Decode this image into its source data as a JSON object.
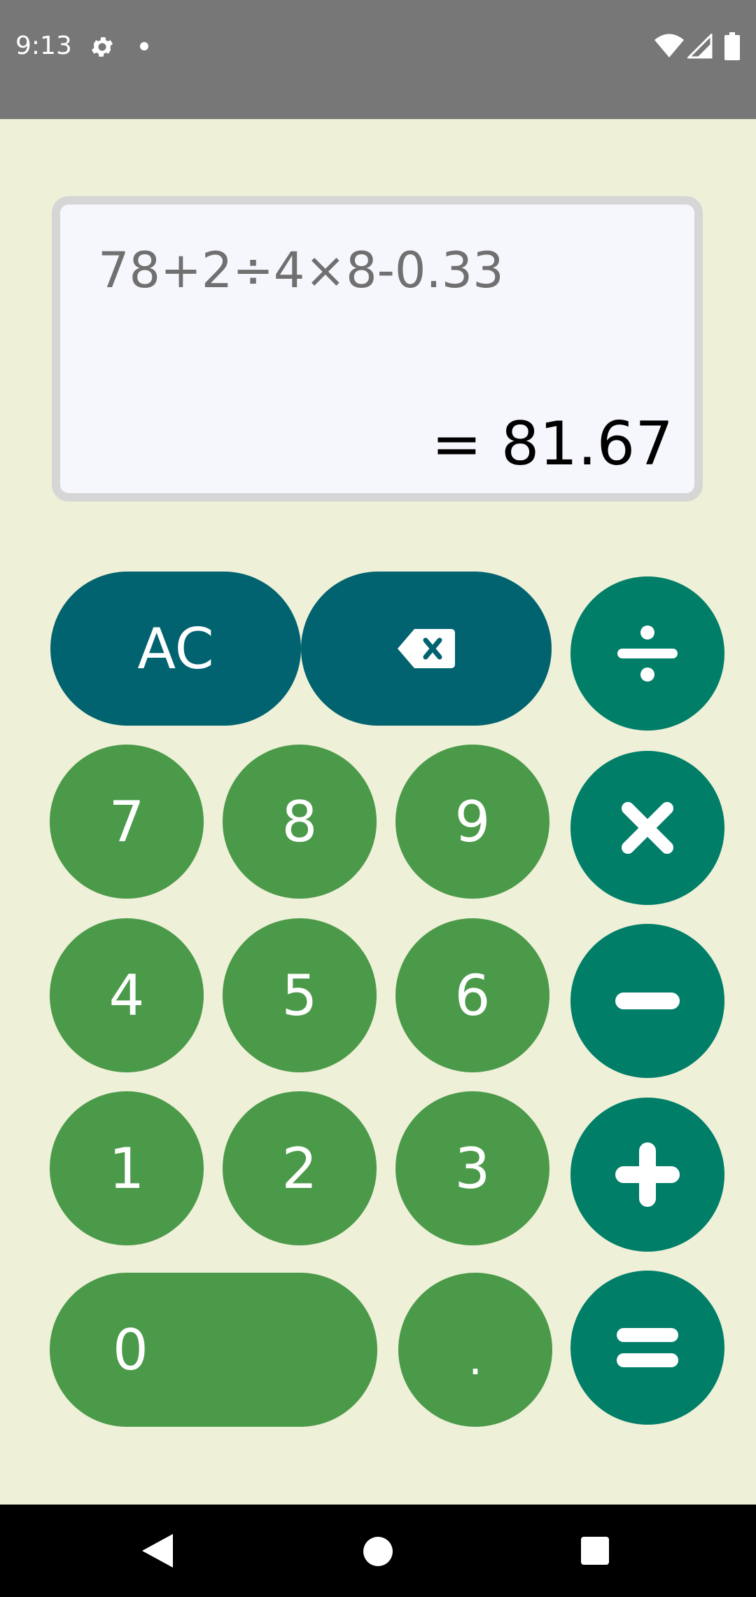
{
  "status_bar": {
    "time": "9:13",
    "icons": [
      "gear-icon",
      "notification-dot-icon",
      "wifi-icon",
      "signal-icon",
      "battery-icon"
    ]
  },
  "display": {
    "expression": "78+2÷4×8-0.33",
    "result": "= 81.67"
  },
  "keypad": {
    "clear": "AC",
    "backspace_icon": "backspace-icon",
    "divide_icon": "divide-icon",
    "multiply_icon": "multiply-icon",
    "minus_icon": "minus-icon",
    "plus_icon": "plus-icon",
    "equals_icon": "equals-icon",
    "digits": {
      "d7": "7",
      "d8": "8",
      "d9": "9",
      "d4": "4",
      "d5": "5",
      "d6": "6",
      "d1": "1",
      "d2": "2",
      "d3": "3",
      "d0": "0",
      "dot": "."
    }
  },
  "colors": {
    "background": "#eff0d8",
    "digit": "#4b9a4a",
    "function": "#01636f",
    "operator": "#007e68",
    "status_bar": "#777777"
  },
  "nav_bar": {
    "icons": [
      "back-icon",
      "home-icon",
      "recent-apps-icon"
    ]
  }
}
